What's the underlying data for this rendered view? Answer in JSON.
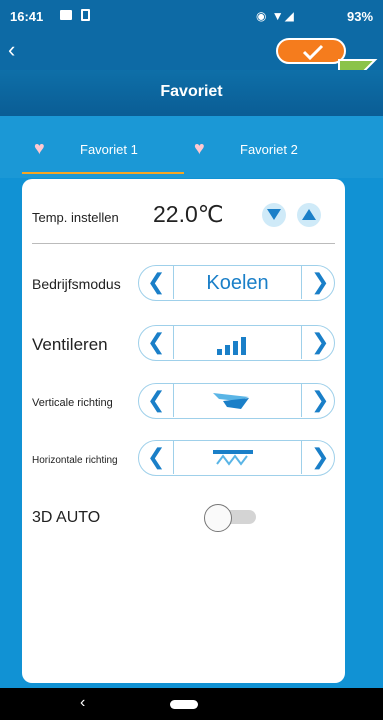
{
  "statusbar": {
    "time": "16:41",
    "battery": "93%"
  },
  "header": {
    "back_icon": "chevron-left-icon",
    "ok_icon": "check-icon"
  },
  "title": "Favoriet",
  "tabs": [
    {
      "label": "Favoriet 1",
      "icon": "heart-icon",
      "selected": true
    },
    {
      "label": "Favoriet 2",
      "icon": "heart-icon",
      "selected": false
    }
  ],
  "temperature": {
    "label": "Temp. instellen",
    "value": "22.0℃"
  },
  "rows": {
    "mode": {
      "label": "Bedrijfsmodus",
      "value": "Koelen"
    },
    "fan": {
      "label": "Ventileren",
      "icon": "fan-speed-bars-icon"
    },
    "vertical": {
      "label": "Verticale richting",
      "icon": "vertical-vane-icon"
    },
    "horizontal": {
      "label": "Horizontale richting",
      "icon": "horizontal-vane-icon"
    }
  },
  "auto3d": {
    "label": "3D AUTO",
    "on": false
  },
  "colors": {
    "header": "#0d6aa5",
    "background": "#1192d4",
    "accent": "#1a7fc8",
    "ok": "#f57c1d",
    "pointer": "#8bc34a"
  }
}
